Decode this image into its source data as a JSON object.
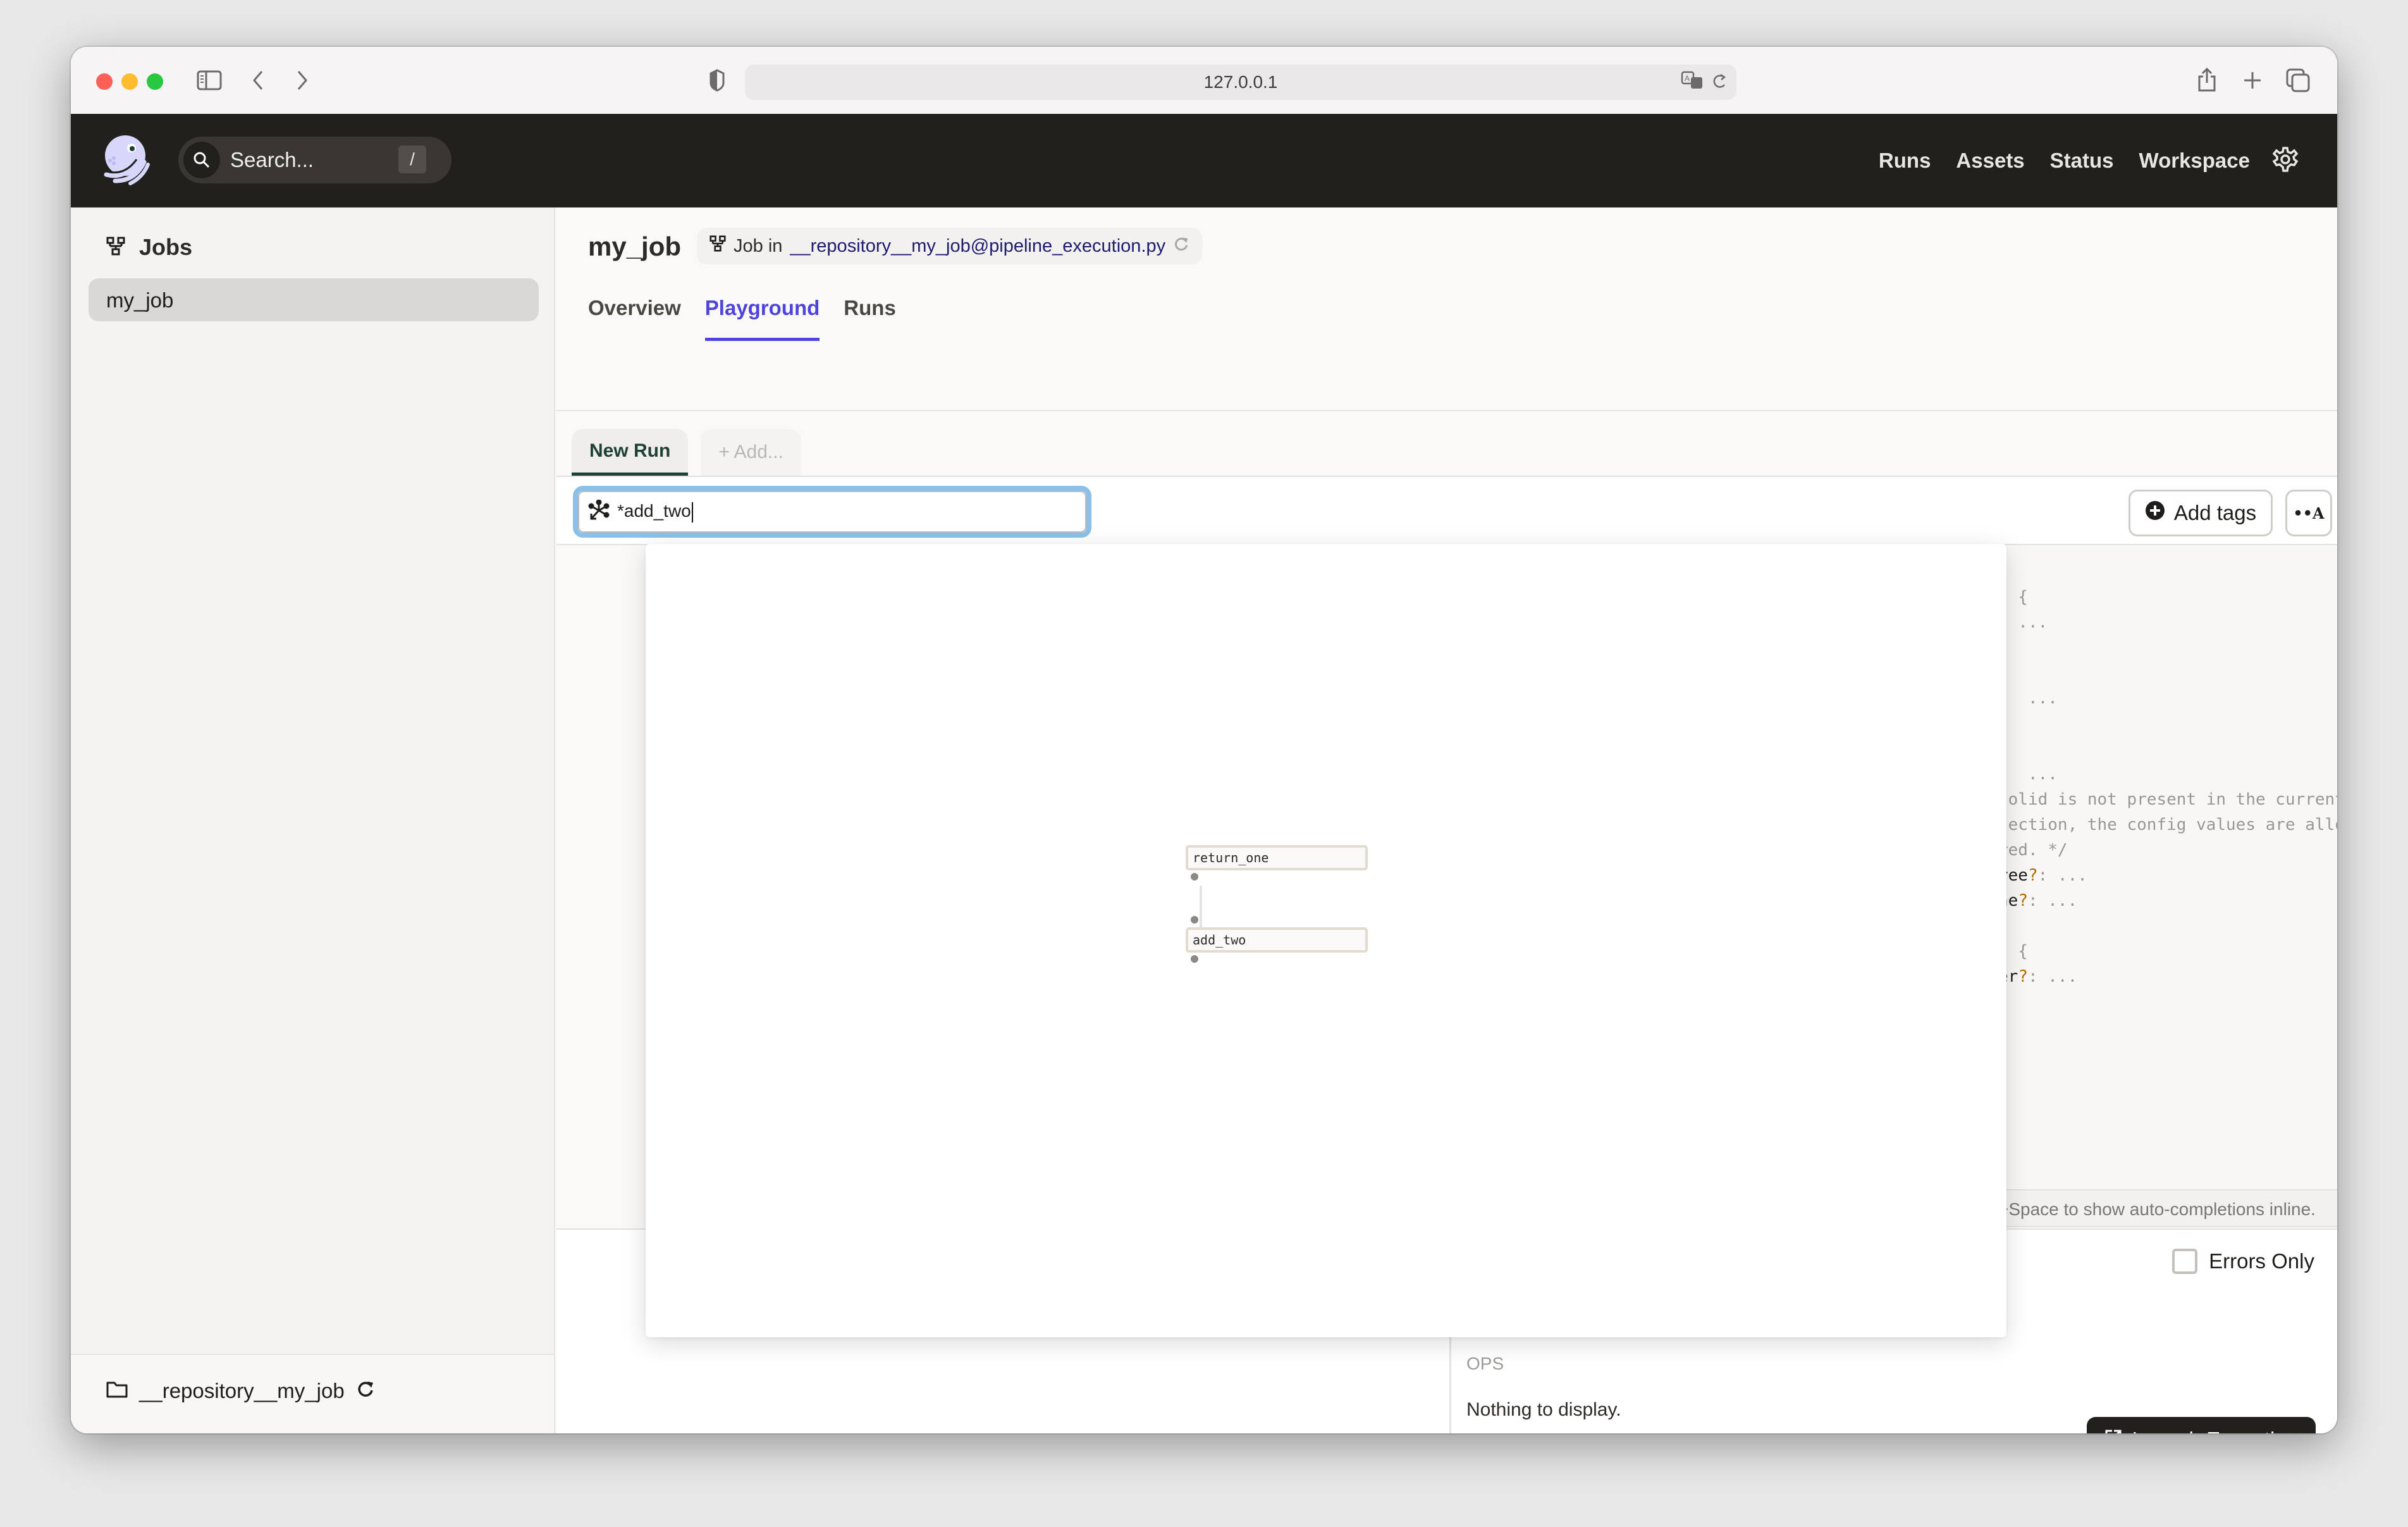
{
  "browser": {
    "url": "127.0.0.1",
    "icons": [
      "sidebar-toggle-icon",
      "back-icon",
      "forward-icon",
      "shield-icon",
      "translate-icon",
      "reload-icon",
      "share-icon",
      "new-tab-icon",
      "tabs-overview-icon"
    ]
  },
  "topnav": {
    "search_placeholder": "Search...",
    "search_shortcut": "/",
    "links": [
      "Runs",
      "Assets",
      "Status",
      "Workspace"
    ]
  },
  "sidebar": {
    "section_title": "Jobs",
    "items": [
      {
        "label": "my_job",
        "selected": true
      }
    ],
    "repository": "__repository__my_job"
  },
  "header": {
    "title": "my_job",
    "job_in_label": "Job in",
    "job_location": "__repository__my_job@pipeline_execution.py"
  },
  "tabs": [
    {
      "label": "Overview",
      "active": false
    },
    {
      "label": "Playground",
      "active": true
    },
    {
      "label": "Runs",
      "active": false
    }
  ],
  "run_tabs": {
    "active": "New Run",
    "add": "+ Add..."
  },
  "toolbar": {
    "op_selection_value": "*add_two",
    "add_tags_label": "Add tags"
  },
  "editor": {
    "lines": [
      {
        "text": ": {"
      },
      {
        "text": "  ..."
      },
      {
        "text": ""
      },
      {
        "text": "{"
      },
      {
        "text": ":  ..."
      },
      {
        "text": ""
      },
      {
        "text": ""
      },
      {
        "text": ":  ..."
      },
      {
        "text": "solid is not present in the current"
      },
      {
        "text": "lection, the config values are allowed"
      },
      {
        "text": "red. */"
      },
      {
        "key": "ree",
        "rest": ": ..."
      },
      {
        "key": "ne",
        "rest": ": ..."
      },
      {
        "text": ""
      },
      {
        "text": ": {"
      },
      {
        "key": "er",
        "rest": ": ..."
      }
    ],
    "hint": "+Space to show auto-completions inline."
  },
  "lower": {
    "errors_only_label": "Errors Only",
    "errors_only_checked": false,
    "ops_label": "OPS",
    "empty_text": "Nothing to display.",
    "launch_label": "Launch Execution"
  },
  "graph": {
    "nodes": [
      {
        "name": "return_one"
      },
      {
        "name": "add_two"
      }
    ],
    "edges": [
      {
        "from": "return_one",
        "to": "add_two"
      }
    ]
  },
  "colors": {
    "accent": "#4f43dd",
    "nav_bg": "#22201c",
    "focus_ring": "#8cc0e6",
    "run_tab_accent": "#1e4035"
  }
}
